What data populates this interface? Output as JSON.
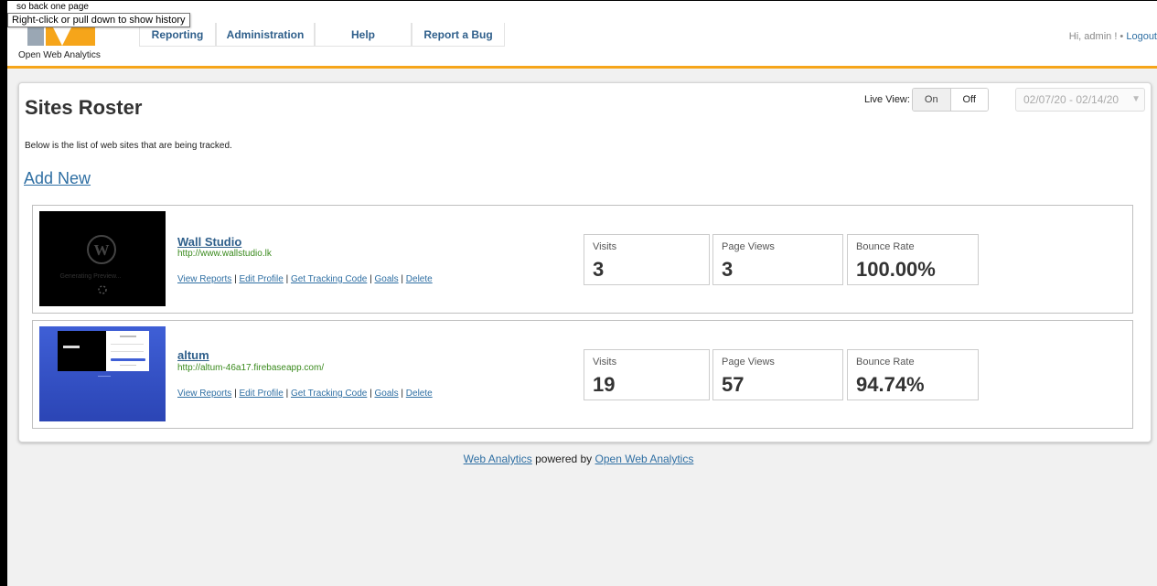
{
  "tooltip": {
    "ghost_text": "so back one page",
    "text": "Right-click or pull down to show history"
  },
  "header": {
    "logo_text": "Open Web Analytics",
    "nav": [
      "Reporting",
      "Administration",
      "Help",
      "Report a Bug"
    ],
    "greeting": "Hi, admin ! •",
    "logout": "Logout",
    "accent_color": "#f6a51a"
  },
  "page": {
    "title": "Sites Roster",
    "description": "Below is the list of web sites that are being tracked.",
    "add_new": "Add New",
    "live_view_label": "Live View:",
    "live_on": "On",
    "live_off": "Off",
    "date_range": "02/07/20 - 02/14/20"
  },
  "sites": [
    {
      "name": "Wall Studio",
      "url": "http://www.wallstudio.lk",
      "thumbnail_text": "Generating Preview...",
      "links": [
        "View Reports",
        "Edit Profile",
        "Get Tracking Code",
        "Goals",
        "Delete"
      ],
      "stats": [
        {
          "label": "Visits",
          "value": "3"
        },
        {
          "label": "Page Views",
          "value": "3"
        },
        {
          "label": "Bounce Rate",
          "value": "100.00%"
        }
      ]
    },
    {
      "name": "altum",
      "url": "http://altum-46a17.firebaseapp.com/",
      "links": [
        "View Reports",
        "Edit Profile",
        "Get Tracking Code",
        "Goals",
        "Delete"
      ],
      "stats": [
        {
          "label": "Visits",
          "value": "19"
        },
        {
          "label": "Page Views",
          "value": "57"
        },
        {
          "label": "Bounce Rate",
          "value": "94.74%"
        }
      ]
    }
  ],
  "footer": {
    "link1": "Web Analytics",
    "middle": " powered by ",
    "link2": "Open Web Analytics"
  }
}
